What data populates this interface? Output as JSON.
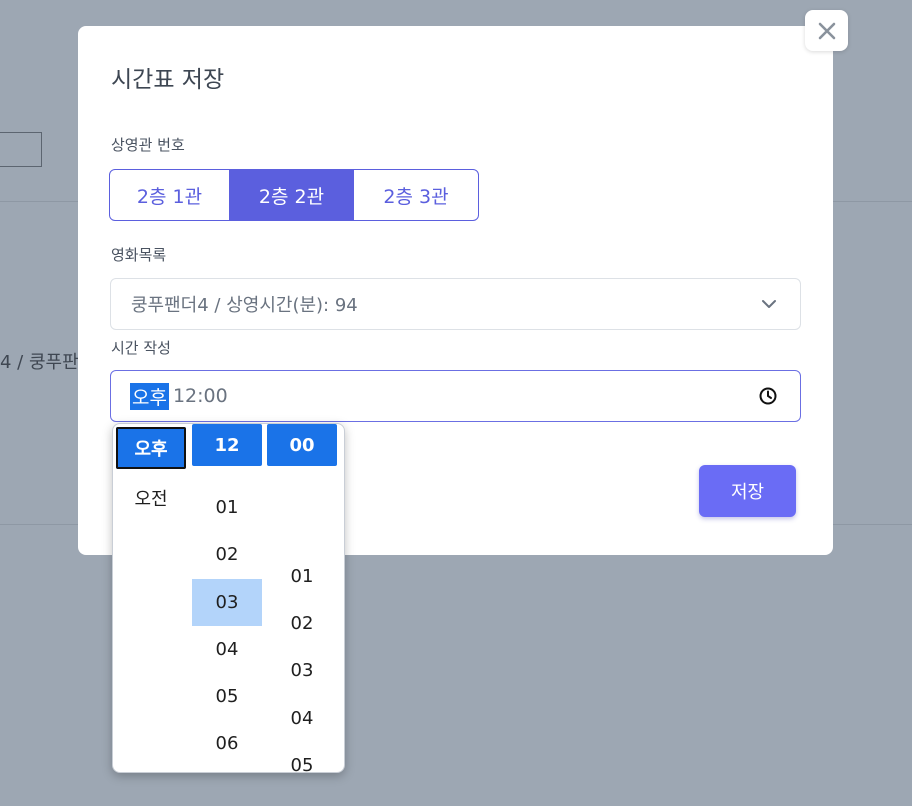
{
  "background": {
    "partial_text": "4 / 쿵푸판"
  },
  "modal": {
    "title": "시간표 저장",
    "close_label": "✕",
    "screen": {
      "label": "상영관 번호",
      "options": [
        "2층 1관",
        "2층 2관",
        "2층 3관"
      ],
      "selected": "2층 2관"
    },
    "movie": {
      "label": "영화목록",
      "value": "쿵푸팬더4 / 상영시간(분): 94"
    },
    "time": {
      "label": "시간 작성",
      "ampm": "오후",
      "value": "12:00"
    },
    "save_label": "저장"
  },
  "picker": {
    "ampm": [
      "오후",
      "오전"
    ],
    "hours": [
      "12",
      "01",
      "02",
      "03",
      "04",
      "05",
      "06"
    ],
    "minutes": [
      "00",
      "01",
      "02",
      "03",
      "04",
      "05"
    ],
    "selected": {
      "ampm": "오후",
      "hour": "12",
      "minute": "00"
    },
    "hovered_hour": "03"
  },
  "colors": {
    "accent": "#5b5fde",
    "save_button": "#6a6cf5",
    "picker_selected": "#1a73e8",
    "picker_hover": "#b3d4fa",
    "backdrop": "#9da7b3"
  }
}
